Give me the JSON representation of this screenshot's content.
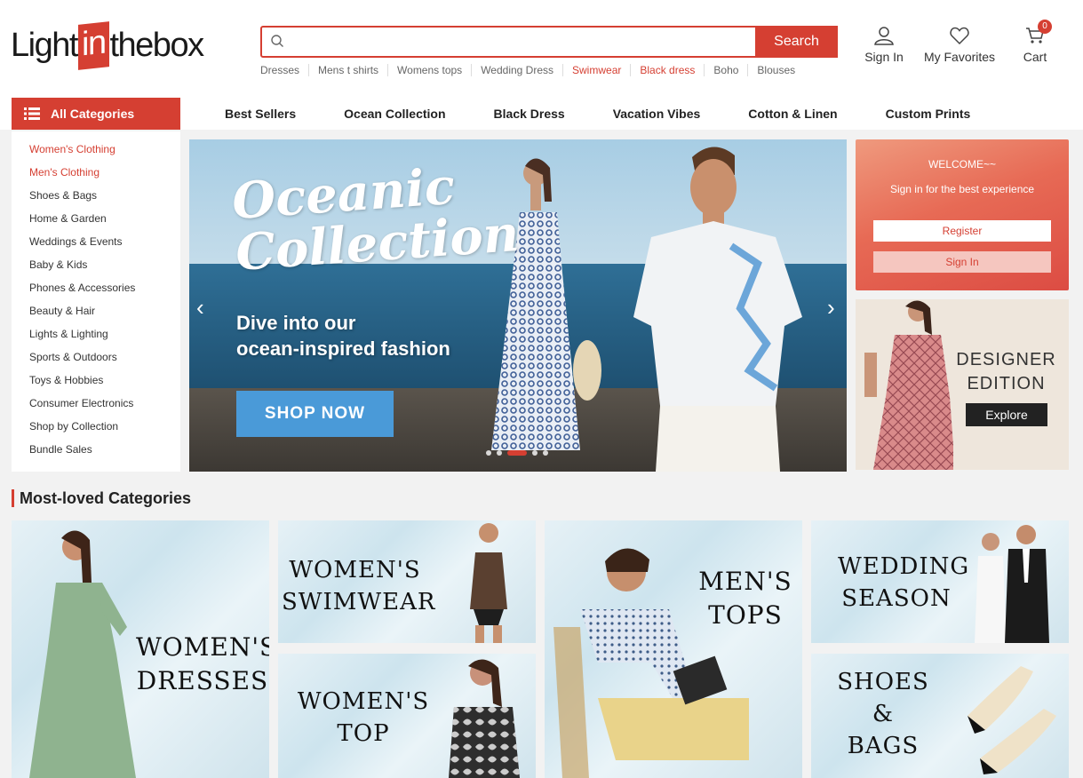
{
  "header": {
    "logo": {
      "part1": "Light",
      "part2": "in",
      "part3": "thebox"
    },
    "search": {
      "placeholder": "",
      "button_label": "Search"
    },
    "hot_searches": [
      {
        "label": "Dresses",
        "highlight": false
      },
      {
        "label": "Mens t shirts",
        "highlight": false
      },
      {
        "label": "Womens tops",
        "highlight": false
      },
      {
        "label": "Wedding Dress",
        "highlight": false
      },
      {
        "label": "Swimwear",
        "highlight": true
      },
      {
        "label": "Black dress",
        "highlight": true
      },
      {
        "label": "Boho",
        "highlight": false
      },
      {
        "label": "Blouses",
        "highlight": false
      }
    ],
    "actions": {
      "sign_in": "Sign In",
      "favorites": "My Favorites",
      "cart": "Cart",
      "cart_count": "0"
    }
  },
  "nav": {
    "all_categories": "All Categories",
    "links": [
      "Best Sellers",
      "Ocean Collection",
      "Black Dress",
      "Vacation Vibes",
      "Cotton & Linen",
      "Custom Prints"
    ]
  },
  "sidebar": {
    "items": [
      {
        "label": "Women's Clothing",
        "highlight": true
      },
      {
        "label": "Men's Clothing",
        "highlight": true
      },
      {
        "label": "Shoes & Bags",
        "highlight": false
      },
      {
        "label": "Home & Garden",
        "highlight": false
      },
      {
        "label": "Weddings & Events",
        "highlight": false
      },
      {
        "label": "Baby & Kids",
        "highlight": false
      },
      {
        "label": "Phones & Accessories",
        "highlight": false
      },
      {
        "label": "Beauty & Hair",
        "highlight": false
      },
      {
        "label": "Lights & Lighting",
        "highlight": false
      },
      {
        "label": "Sports & Outdoors",
        "highlight": false
      },
      {
        "label": "Toys & Hobbies",
        "highlight": false
      },
      {
        "label": "Consumer Electronics",
        "highlight": false
      },
      {
        "label": "Shop by Collection",
        "highlight": false
      },
      {
        "label": "Bundle Sales",
        "highlight": false
      }
    ]
  },
  "hero": {
    "title_line1": "Oceanic",
    "title_line2": "Collection",
    "subtitle_line1": "Dive into our",
    "subtitle_line2": "ocean-inspired fashion",
    "cta": "SHOP NOW",
    "slide_count": 5,
    "active_slide": 3
  },
  "welcome": {
    "title": "WELCOME~~",
    "subtitle": "Sign in for the best experience",
    "register": "Register",
    "sign_in": "Sign In"
  },
  "designer": {
    "line1": "DESIGNER",
    "line2": "EDITION",
    "cta": "Explore"
  },
  "most_loved": {
    "heading": "Most-loved Categories",
    "tiles": [
      {
        "line1": "WOMEN'S",
        "line2": "DRESSES"
      },
      {
        "line1": "WOMEN'S",
        "line2": "SWIMWEAR"
      },
      {
        "line1": "WOMEN'S",
        "line2": "TOP"
      },
      {
        "line1": "MEN'S",
        "line2": "TOPS"
      },
      {
        "line1": "WEDDING",
        "line2": "SEASON"
      },
      {
        "line1": "SHOES",
        "line2": "&",
        "line3": "BAGS"
      }
    ]
  },
  "colors": {
    "brand": "#d53f32",
    "cta_blue": "#4a9ad8"
  }
}
